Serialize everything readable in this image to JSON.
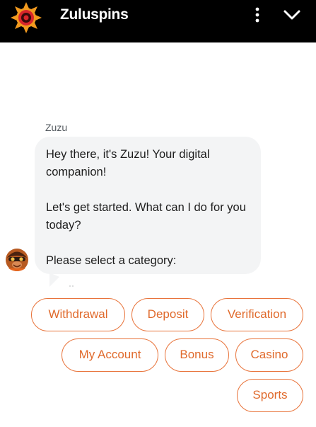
{
  "header": {
    "brand": "Zuluspins",
    "logo_icon": "sun-logo-icon",
    "menu_icon": "more-vertical-icon",
    "collapse_icon": "chevron-down-icon"
  },
  "chat": {
    "sender": "Zuzu",
    "message_lines": [
      "Hey there, it's Zuzu! Your digital companion!",
      "Let's get started. What can I do for you today?",
      "Please select a category:"
    ],
    "avatar_icon": "bot-avatar-icon"
  },
  "categories": [
    "Withdrawal",
    "Deposit",
    "Verification",
    "My Account",
    "Bonus",
    "Casino",
    "Sports"
  ],
  "colors": {
    "header_bg": "#000000",
    "bubble_bg": "#f3f4f5",
    "chip_accent": "#e8733a",
    "logo_orange": "#f29a1f",
    "logo_red": "#d9262b"
  }
}
